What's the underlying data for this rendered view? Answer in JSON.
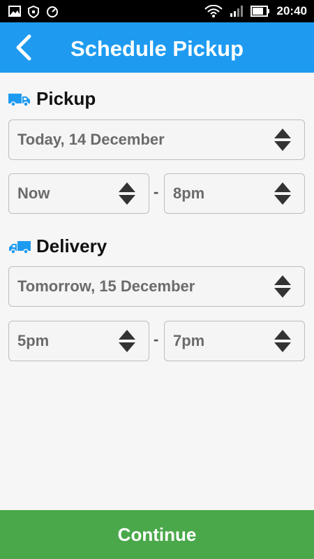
{
  "status_bar": {
    "time": "20:40",
    "left_icons": [
      "image-icon",
      "shield-icon",
      "speed-gauge-icon"
    ],
    "right_icons": [
      "wifi-icon",
      "signal-icon",
      "battery-icon"
    ]
  },
  "header": {
    "title": "Schedule Pickup",
    "back_icon": "back-arrow-icon"
  },
  "pickup": {
    "label": "Pickup",
    "icon": "truck-icon",
    "date": "Today, 14 December",
    "time_from": "Now",
    "time_to": "8pm",
    "separator": "-"
  },
  "delivery": {
    "label": "Delivery",
    "icon": "truck-icon",
    "date": "Tomorrow, 15 December",
    "time_from": "5pm",
    "time_to": "7pm",
    "separator": "-"
  },
  "footer": {
    "continue_label": "Continue"
  },
  "colors": {
    "app_bar": "#1e9bf0",
    "truck": "#1e9bf0",
    "continue_button": "#4aa84a",
    "field_text": "#6b6b6b",
    "background": "#f6f6f6"
  }
}
